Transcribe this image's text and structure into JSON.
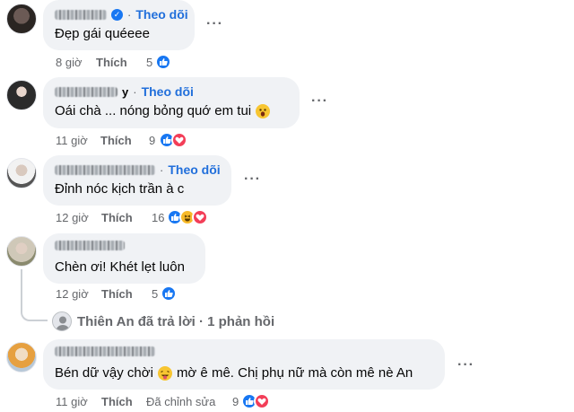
{
  "follow_label": "Theo dõi",
  "like_label": "Thích",
  "more_label": "···",
  "comments": [
    {
      "name_tail": "",
      "verified": true,
      "text": "Đẹp gái quéeee",
      "time": "8 giờ",
      "count": "5",
      "reactions": [
        "like"
      ],
      "edited": ""
    },
    {
      "name_tail": "y",
      "verified": false,
      "text": "Oái chà ... nóng bỏng quớ em tui",
      "time": "11 giờ",
      "count": "9",
      "reactions": [
        "like",
        "love"
      ],
      "edited": ""
    },
    {
      "name_tail": "",
      "verified": false,
      "text": "Đỉnh nóc kịch trần à c",
      "time": "12 giờ",
      "count": "16",
      "reactions": [
        "like",
        "haha",
        "love"
      ],
      "edited": ""
    },
    {
      "name_tail": "",
      "verified": false,
      "text": "Chèn ơi! Khét lẹt luôn",
      "time": "12 giờ",
      "count": "5",
      "reactions": [
        "like"
      ],
      "edited": ""
    },
    {
      "name_tail": "",
      "verified": false,
      "text": "Bén dữ vậy chời",
      "text_after_emoji": "mờ ê mê. Chị phụ nữ mà còn mê nè An",
      "time": "11 giờ",
      "count": "9",
      "reactions": [
        "like",
        "love"
      ],
      "edited": "Đã chỉnh sửa"
    }
  ],
  "reply_summary": "Thiên An đã trả lời · 1 phản hồi",
  "colors": {
    "bubble": "#f0f2f5",
    "link": "#216fdb",
    "meta": "#65676b",
    "like": "#1877f2",
    "love": "#f33e58"
  }
}
